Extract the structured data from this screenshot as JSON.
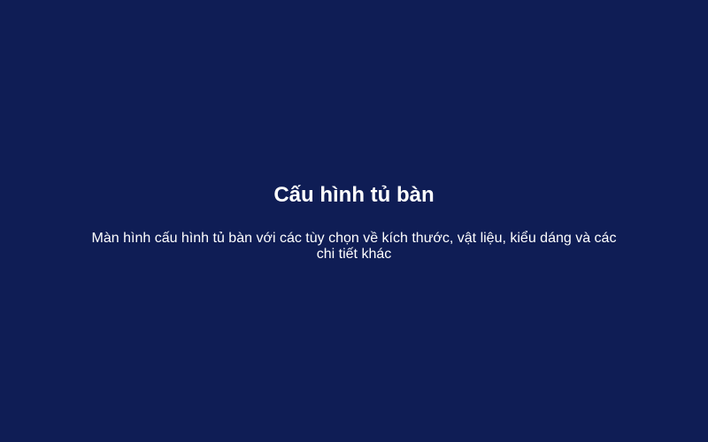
{
  "screen": {
    "title": "Cấu hình tủ bàn",
    "description": "Màn hình cấu hình tủ bàn với các tùy chọn về kích thước, vật liệu, kiểu dáng và các chi tiết khác"
  },
  "colors": {
    "background": "#0f1d55",
    "text": "#ffffff"
  }
}
